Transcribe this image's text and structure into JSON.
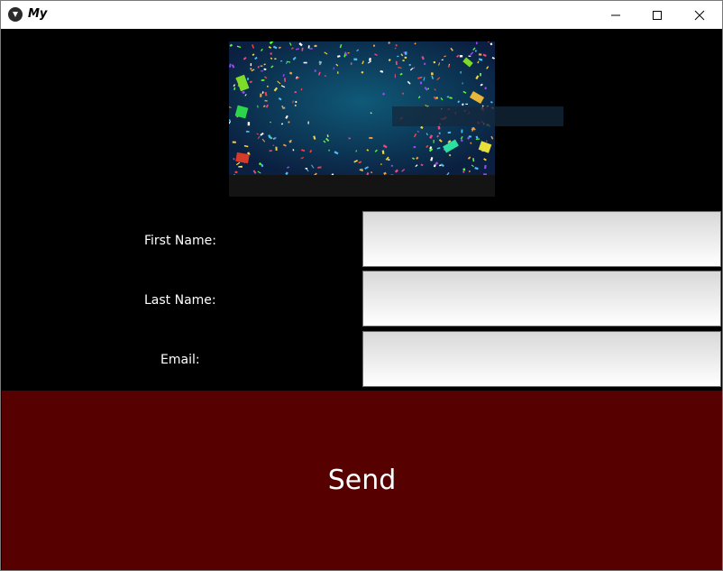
{
  "window": {
    "title": "My",
    "app_icon": "kivy-app-icon",
    "controls": {
      "minimize_icon": "minimize-icon",
      "maximize_icon": "maximize-icon",
      "close_icon": "close-icon"
    }
  },
  "banner": {
    "image": "confetti-celebration-image"
  },
  "form": {
    "first_name_label": "First Name:",
    "last_name_label": "Last Name:",
    "email_label": "Email:",
    "first_name_value": "",
    "last_name_value": "",
    "email_value": ""
  },
  "actions": {
    "send_label": "Send"
  },
  "colors": {
    "background": "#000000",
    "send_button": "#560000",
    "input_top": "#d8d8d8",
    "input_bottom": "#ffffff",
    "label_text": "#ffffff"
  }
}
